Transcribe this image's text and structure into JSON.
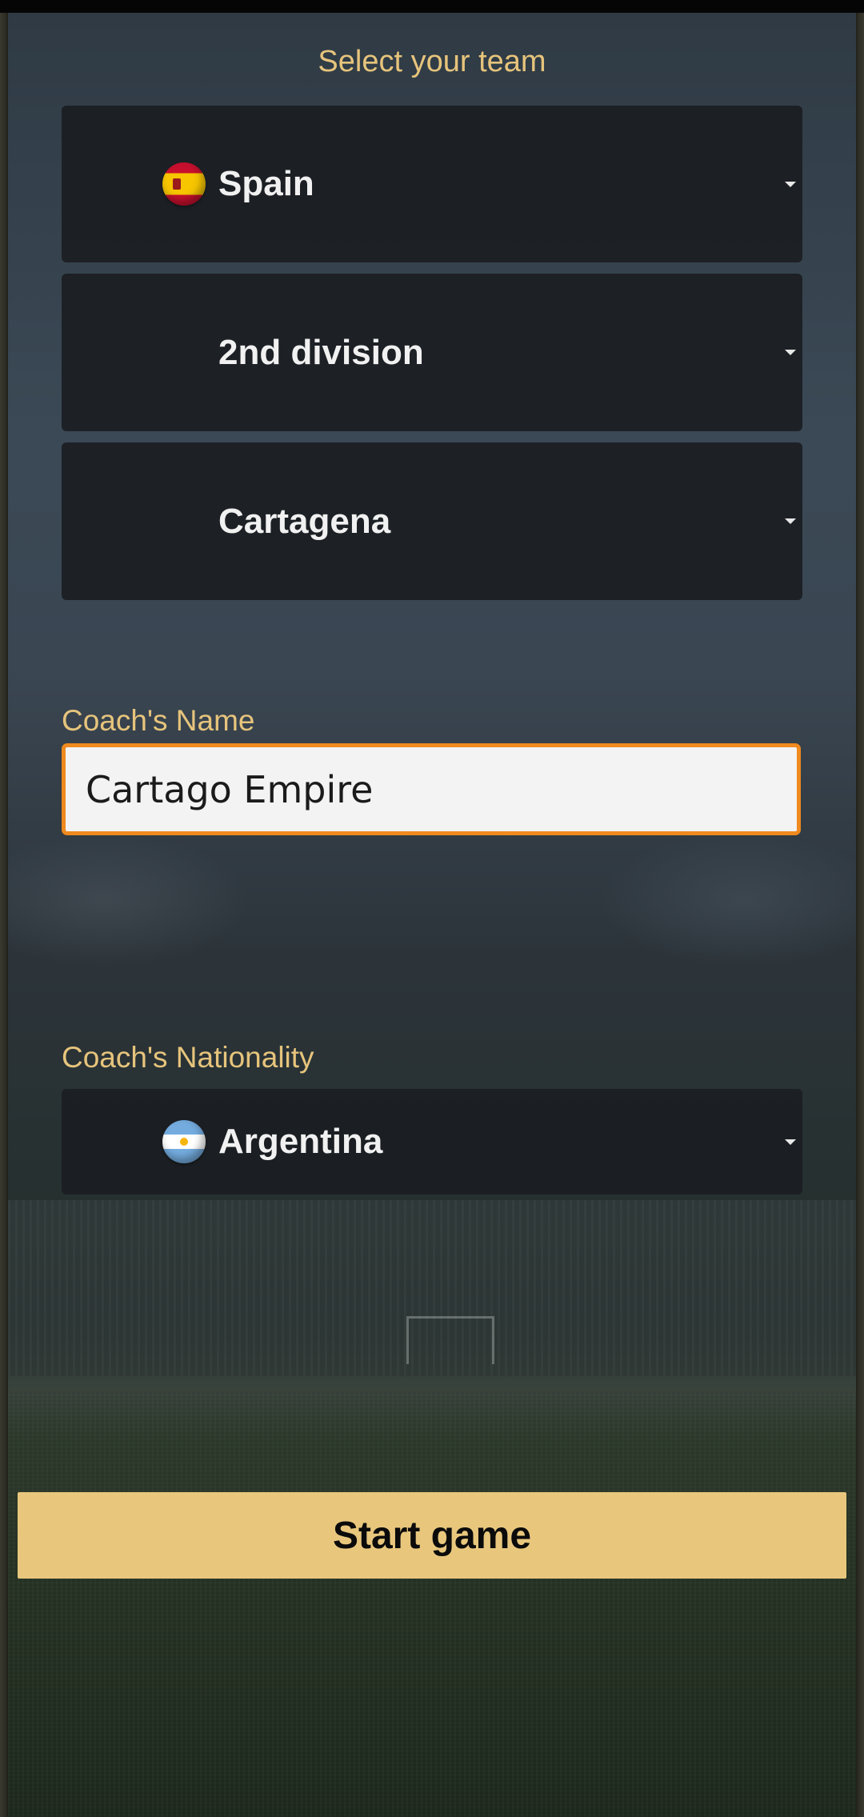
{
  "header": {
    "title": "Select your team"
  },
  "team_selection": {
    "country": {
      "value": "Spain",
      "flag_icon": "spain-flag-icon"
    },
    "division": {
      "value": "2nd division"
    },
    "team": {
      "value": "Cartagena"
    }
  },
  "coach": {
    "name_label": "Coach's Name",
    "name_value": "Cartago Empire",
    "nationality_label": "Coach's Nationality",
    "nationality": {
      "value": "Argentina",
      "flag_icon": "argentina-flag-icon"
    }
  },
  "actions": {
    "start_label": "Start game"
  },
  "colors": {
    "accent_gold": "#e6c47c",
    "button_gold": "#e8c77d",
    "input_focus_border": "#ef8a1e",
    "select_bg": "#1b1e22"
  }
}
